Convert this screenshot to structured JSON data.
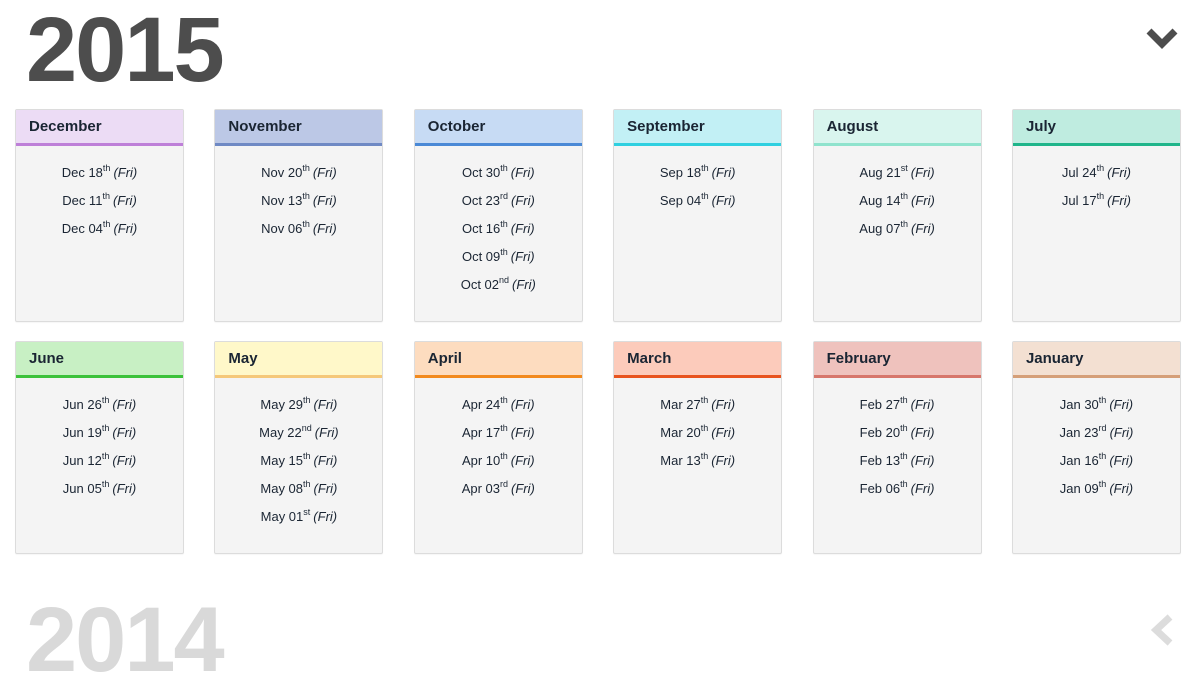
{
  "current_year": "2015",
  "previous_year": "2014",
  "icons": {
    "collapse": "chevron-down-icon",
    "expand": "chevron-left-icon"
  },
  "months": [
    {
      "name": "December",
      "bg": "#ecdcf5",
      "accent": "#be7fd8",
      "dates": [
        {
          "md": "Dec 18",
          "suffix": "th",
          "dow": "(Fri)"
        },
        {
          "md": "Dec 11",
          "suffix": "th",
          "dow": "(Fri)"
        },
        {
          "md": "Dec 04",
          "suffix": "th",
          "dow": "(Fri)"
        }
      ]
    },
    {
      "name": "November",
      "bg": "#bcc8e6",
      "accent": "#6f89c4",
      "dates": [
        {
          "md": "Nov 20",
          "suffix": "th",
          "dow": "(Fri)"
        },
        {
          "md": "Nov 13",
          "suffix": "th",
          "dow": "(Fri)"
        },
        {
          "md": "Nov 06",
          "suffix": "th",
          "dow": "(Fri)"
        }
      ]
    },
    {
      "name": "October",
      "bg": "#c7dbf4",
      "accent": "#4a89d6",
      "dates": [
        {
          "md": "Oct 30",
          "suffix": "th",
          "dow": "(Fri)"
        },
        {
          "md": "Oct 23",
          "suffix": "rd",
          "dow": "(Fri)"
        },
        {
          "md": "Oct 16",
          "suffix": "th",
          "dow": "(Fri)"
        },
        {
          "md": "Oct 09",
          "suffix": "th",
          "dow": "(Fri)"
        },
        {
          "md": "Oct 02",
          "suffix": "nd",
          "dow": "(Fri)"
        }
      ]
    },
    {
      "name": "September",
      "bg": "#c2f0f5",
      "accent": "#2fd0e0",
      "dates": [
        {
          "md": "Sep 18",
          "suffix": "th",
          "dow": "(Fri)"
        },
        {
          "md": "Sep 04",
          "suffix": "th",
          "dow": "(Fri)"
        }
      ]
    },
    {
      "name": "August",
      "bg": "#d9f5ee",
      "accent": "#8fe3cd",
      "dates": [
        {
          "md": "Aug 21",
          "suffix": "st",
          "dow": "(Fri)"
        },
        {
          "md": "Aug 14",
          "suffix": "th",
          "dow": "(Fri)"
        },
        {
          "md": "Aug 07",
          "suffix": "th",
          "dow": "(Fri)"
        }
      ]
    },
    {
      "name": "July",
      "bg": "#bfece0",
      "accent": "#1fb58a",
      "dates": [
        {
          "md": "Jul 24",
          "suffix": "th",
          "dow": "(Fri)"
        },
        {
          "md": "Jul 17",
          "suffix": "th",
          "dow": "(Fri)"
        }
      ]
    },
    {
      "name": "June",
      "bg": "#c8f0c4",
      "accent": "#3cc23a",
      "dates": [
        {
          "md": "Jun 26",
          "suffix": "th",
          "dow": "(Fri)"
        },
        {
          "md": "Jun 19",
          "suffix": "th",
          "dow": "(Fri)"
        },
        {
          "md": "Jun 12",
          "suffix": "th",
          "dow": "(Fri)"
        },
        {
          "md": "Jun 05",
          "suffix": "th",
          "dow": "(Fri)"
        }
      ]
    },
    {
      "name": "May",
      "bg": "#fff8c9",
      "accent": "#f5c87a",
      "dates": [
        {
          "md": "May 29",
          "suffix": "th",
          "dow": "(Fri)"
        },
        {
          "md": "May 22",
          "suffix": "nd",
          "dow": "(Fri)"
        },
        {
          "md": "May 15",
          "suffix": "th",
          "dow": "(Fri)"
        },
        {
          "md": "May 08",
          "suffix": "th",
          "dow": "(Fri)"
        },
        {
          "md": "May 01",
          "suffix": "st",
          "dow": "(Fri)"
        }
      ]
    },
    {
      "name": "April",
      "bg": "#fddcbf",
      "accent": "#f28a1e",
      "dates": [
        {
          "md": "Apr 24",
          "suffix": "th",
          "dow": "(Fri)"
        },
        {
          "md": "Apr 17",
          "suffix": "th",
          "dow": "(Fri)"
        },
        {
          "md": "Apr 10",
          "suffix": "th",
          "dow": "(Fri)"
        },
        {
          "md": "Apr 03",
          "suffix": "rd",
          "dow": "(Fri)"
        }
      ]
    },
    {
      "name": "March",
      "bg": "#fccbbb",
      "accent": "#e8541f",
      "dates": [
        {
          "md": "Mar 27",
          "suffix": "th",
          "dow": "(Fri)"
        },
        {
          "md": "Mar 20",
          "suffix": "th",
          "dow": "(Fri)"
        },
        {
          "md": "Mar 13",
          "suffix": "th",
          "dow": "(Fri)"
        }
      ]
    },
    {
      "name": "February",
      "bg": "#efc2bd",
      "accent": "#d7766b",
      "dates": [
        {
          "md": "Feb 27",
          "suffix": "th",
          "dow": "(Fri)"
        },
        {
          "md": "Feb 20",
          "suffix": "th",
          "dow": "(Fri)"
        },
        {
          "md": "Feb 13",
          "suffix": "th",
          "dow": "(Fri)"
        },
        {
          "md": "Feb 06",
          "suffix": "th",
          "dow": "(Fri)"
        }
      ]
    },
    {
      "name": "January",
      "bg": "#f3e0d2",
      "accent": "#d59f78",
      "dates": [
        {
          "md": "Jan 30",
          "suffix": "th",
          "dow": "(Fri)"
        },
        {
          "md": "Jan 23",
          "suffix": "rd",
          "dow": "(Fri)"
        },
        {
          "md": "Jan 16",
          "suffix": "th",
          "dow": "(Fri)"
        },
        {
          "md": "Jan 09",
          "suffix": "th",
          "dow": "(Fri)"
        }
      ]
    }
  ]
}
